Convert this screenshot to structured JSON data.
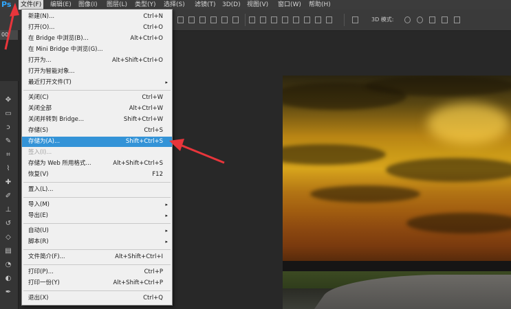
{
  "app": {
    "logo": "Ps"
  },
  "menubar": {
    "items": [
      "文件(F)",
      "编辑(E)",
      "图像(I)",
      "图层(L)",
      "类型(Y)",
      "选择(S)",
      "滤镜(T)",
      "3D(D)",
      "视图(V)",
      "窗口(W)",
      "帮助(H)"
    ]
  },
  "options_bar": {
    "label_3d": "3D 模式:"
  },
  "doc_tab": {
    "label": "00"
  },
  "file_menu": {
    "items": [
      {
        "label": "新建(N)...",
        "shortcut": "Ctrl+N"
      },
      {
        "label": "打开(O)...",
        "shortcut": "Ctrl+O"
      },
      {
        "label": "在 Bridge 中浏览(B)...",
        "shortcut": "Alt+Ctrl+O"
      },
      {
        "label": "在 Mini Bridge 中浏览(G)...",
        "shortcut": ""
      },
      {
        "label": "打开为...",
        "shortcut": "Alt+Shift+Ctrl+O"
      },
      {
        "label": "打开为智能对象...",
        "shortcut": ""
      },
      {
        "label": "最近打开文件(T)",
        "shortcut": "▸"
      },
      {
        "label": "关闭(C)",
        "shortcut": "Ctrl+W"
      },
      {
        "label": "关闭全部",
        "shortcut": "Alt+Ctrl+W"
      },
      {
        "label": "关闭并转到 Bridge...",
        "shortcut": "Shift+Ctrl+W"
      },
      {
        "label": "存储(S)",
        "shortcut": "Ctrl+S"
      },
      {
        "label": "存储为(A)...",
        "shortcut": "Shift+Ctrl+S"
      },
      {
        "label": "签入(I)...",
        "shortcut": ""
      },
      {
        "label": "存储为 Web 所用格式...",
        "shortcut": "Alt+Shift+Ctrl+S"
      },
      {
        "label": "恢复(V)",
        "shortcut": "F12"
      },
      {
        "label": "置入(L)...",
        "shortcut": ""
      },
      {
        "label": "导入(M)",
        "shortcut": "▸"
      },
      {
        "label": "导出(E)",
        "shortcut": "▸"
      },
      {
        "label": "自动(U)",
        "shortcut": "▸"
      },
      {
        "label": "脚本(R)",
        "shortcut": "▸"
      },
      {
        "label": "文件简介(F)...",
        "shortcut": "Alt+Shift+Ctrl+I"
      },
      {
        "label": "打印(P)...",
        "shortcut": "Ctrl+P"
      },
      {
        "label": "打印一份(Y)",
        "shortcut": "Alt+Shift+Ctrl+P"
      },
      {
        "label": "退出(X)",
        "shortcut": "Ctrl+Q"
      }
    ]
  },
  "colors": {
    "highlight": "#3393d7",
    "arrow": "#e8353b",
    "accent": "#31a8ff"
  }
}
